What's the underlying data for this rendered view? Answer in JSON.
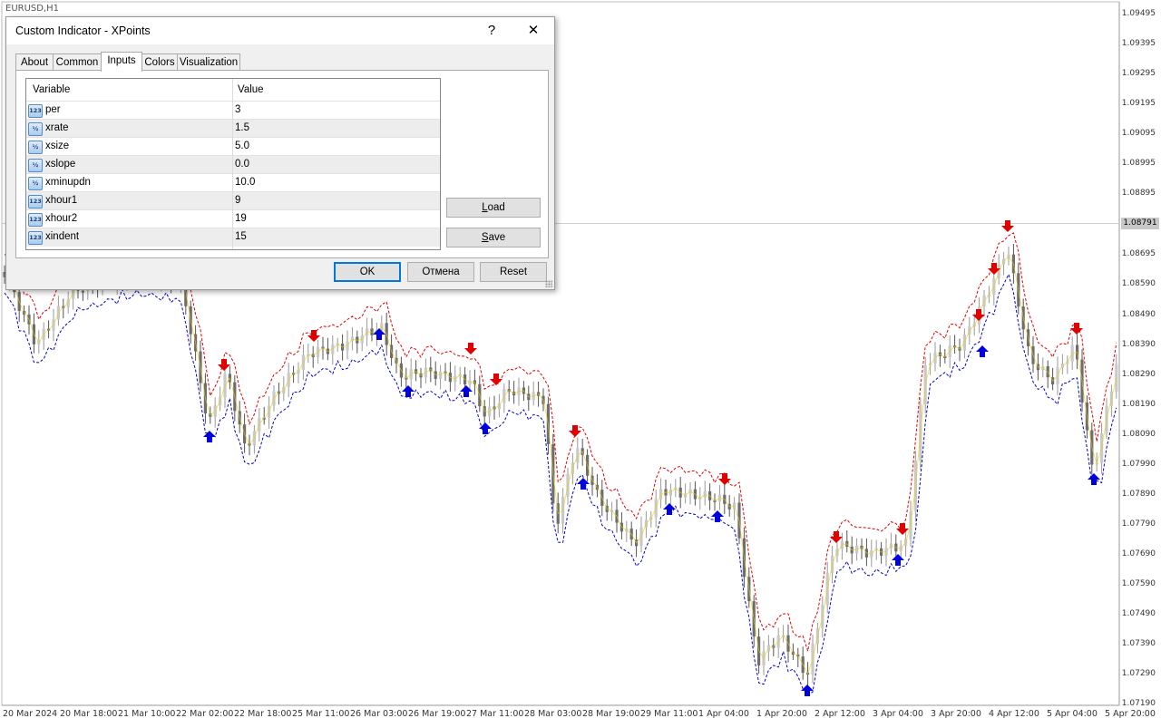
{
  "chart": {
    "symbol_title": "EURUSD,H1",
    "current_price": "1.08791",
    "price_labels": [
      "1.09495",
      "1.09395",
      "1.09295",
      "1.09195",
      "1.09095",
      "1.08995",
      "1.08895",
      "1.08695",
      "1.08590",
      "1.08490",
      "1.08390",
      "1.08290",
      "1.08190",
      "1.08090",
      "1.07990",
      "1.07890",
      "1.07790",
      "1.07690",
      "1.07590",
      "1.07490",
      "1.07390",
      "1.07290",
      "1.07190"
    ],
    "time_labels": [
      "20 Mar 2024",
      "20 Mar 18:00",
      "21 Mar 10:00",
      "22 Mar 02:00",
      "22 Mar 18:00",
      "25 Mar 11:00",
      "26 Mar 03:00",
      "26 Mar 19:00",
      "27 Mar 11:00",
      "28 Mar 03:00",
      "28 Mar 19:00",
      "29 Mar 11:00",
      "1 Apr 04:00",
      "1 Apr 20:00",
      "2 Apr 12:00",
      "3 Apr 04:00",
      "3 Apr 20:00",
      "4 Apr 12:00",
      "5 Apr 04:00",
      "5 Apr 20:00"
    ],
    "colors": {
      "bull": "#c9c9c9",
      "bear": "#6e6e6e",
      "upper_band": "#e00000",
      "lower_band": "#0000cc",
      "mid_line": "#e8d000",
      "sell_arrow": "#e00000",
      "buy_arrow": "#0000dd"
    }
  },
  "dialog": {
    "title": "Custom Indicator - XPoints",
    "help_label": "?",
    "close_label": "✕",
    "tabs": [
      "About",
      "Common",
      "Inputs",
      "Colors",
      "Visualization"
    ],
    "active_tab": "Inputs",
    "table": {
      "headers": [
        "Variable",
        "Value"
      ],
      "rows": [
        {
          "type": "123",
          "name": "per",
          "value": "3"
        },
        {
          "type": "½",
          "name": "xrate",
          "value": "1.5"
        },
        {
          "type": "½",
          "name": "xsize",
          "value": "5.0"
        },
        {
          "type": "½",
          "name": "xslope",
          "value": "0.0"
        },
        {
          "type": "½",
          "name": "xminupdn",
          "value": "10.0"
        },
        {
          "type": "123",
          "name": "xhour1",
          "value": "9"
        },
        {
          "type": "123",
          "name": "xhour2",
          "value": "19"
        },
        {
          "type": "123",
          "name": "xindent",
          "value": "15"
        }
      ]
    },
    "load_label_u": "L",
    "load_label_rest": "oad",
    "save_label_u": "S",
    "save_label_rest": "ave",
    "ok_label": "OK",
    "cancel_label": "Отмена",
    "reset_label": "Reset"
  }
}
